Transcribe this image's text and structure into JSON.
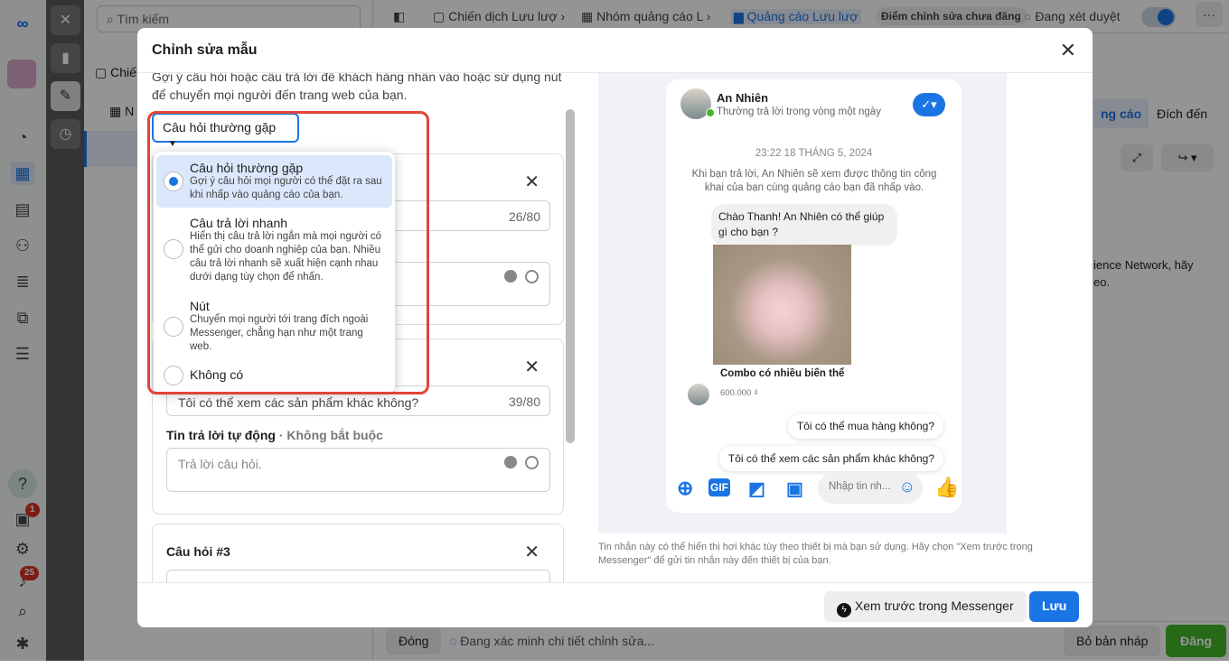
{
  "background": {
    "search_placeholder": "Tìm kiếm",
    "tree": {
      "item1": "Chiế",
      "item2": "N"
    },
    "breadcrumbs": [
      "Chiến dịch Lưu lượ",
      "Nhóm quảng cáo L",
      "Quảng cáo Lưu lượ"
    ],
    "unpublished_badge": "Điểm chỉnh sửa chưa đăng",
    "status": "Đang xét duyệt",
    "more": "···",
    "tabs": [
      "ng cáo",
      "Đích đến"
    ],
    "side_text": "ience Network, hãy\neo.",
    "bottom": {
      "close": "Đóng",
      "verifying": "Đang xác minh chi tiết chỉnh sửa...",
      "discard": "Bỏ bản nháp",
      "publish": "Đăng"
    },
    "badges": {
      "notifications_1": "1",
      "notifications_25": "25"
    },
    "colors": {
      "accent": "#1b74e4",
      "publish": "#42b72a",
      "badge": "#d93025",
      "highlight": "#e0453a"
    }
  },
  "modal": {
    "title": "Chỉnh sửa mẫu",
    "description": "Gợi ý câu hỏi hoặc câu trả lời để khách hàng nhấn vào hoặc sử dụng nút để chuyển mọi người đến trang web của bạn.",
    "dropdown_value": "Câu hỏi thường gặp",
    "options": [
      {
        "title": "Câu hỏi thường gặp",
        "desc": "Gợi ý câu hỏi mọi người có thể đặt ra sau khi nhấp vào quảng cáo của bạn.",
        "selected": true
      },
      {
        "title": "Câu trả lời nhanh",
        "desc": "Hiển thị câu trả lời ngắn mà mọi người có thể gửi cho doanh nghiệp của bạn. Nhiều câu trả lời nhanh sẽ xuất hiện cạnh nhau dưới dạng tùy chọn để nhấn.",
        "selected": false
      },
      {
        "title": "Nút",
        "desc": "Chuyển mọi người tới trang đích ngoài Messenger, chẳng hạn như một trang web.",
        "selected": false
      },
      {
        "title": "Không có",
        "desc": "",
        "selected": false
      }
    ],
    "q1": {
      "count": "26/80"
    },
    "q2": {
      "value": "Tôi có thể xem các sản phẩm khác không?",
      "count": "39/80",
      "auto_reply_label": "Tin trả lời tự động",
      "optional": "· Không bắt buộc",
      "auto_reply_placeholder": "Trả lời câu hỏi."
    },
    "q3": {
      "title": "Câu hỏi #3"
    },
    "preview": {
      "page_name": "An Nhiên",
      "response_time": "Thường trả lời trong vòng một ngày",
      "timestamp": "23:22 18 THÁNG 5, 2024",
      "privacy": "Khi bạn trả lời, An Nhiên sẽ xem được thông tin công khai của bạn cùng quảng cáo bạn đã nhấp vào.",
      "greeting": "Chào Thanh! An Nhiên có thể giúp gì cho bạn ?",
      "product_name": "Combo có nhiều biến thể",
      "price": "600.000 ₫",
      "faq1": "Tôi có thể mua hàng không?",
      "faq2": "Tôi có thể xem các sản phẩm khác không?",
      "input_placeholder": "Nhập tin nh...",
      "gif": "GIF"
    },
    "note": "Tin nhắn này có thể hiển thị hơi khác tùy theo thiết bị mà bạn sử dụng. Hãy chọn \"Xem trước trong Messenger\" để gửi tin nhắn này đến thiết bị của bạn.",
    "preview_button": "Xem trước trong Messenger",
    "save_button": "Lưu"
  }
}
